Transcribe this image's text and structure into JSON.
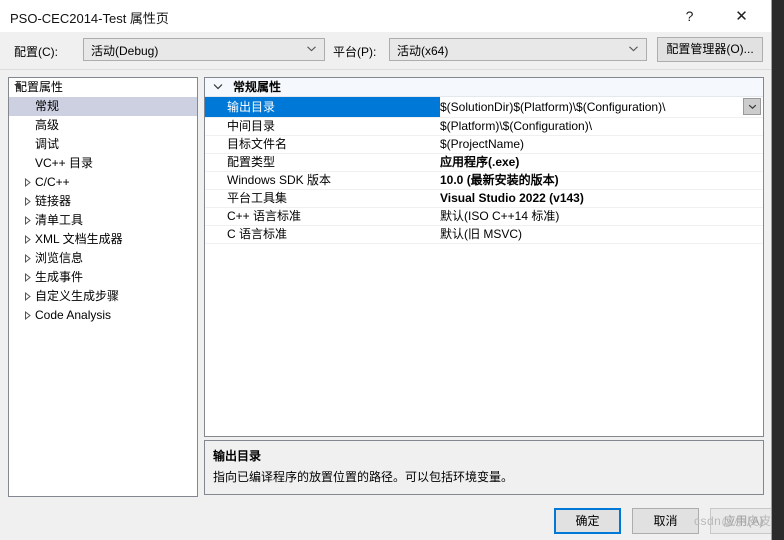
{
  "window": {
    "title": "PSO-CEC2014-Test 属性页",
    "help_icon": "question-mark-icon",
    "close_icon": "close-icon"
  },
  "configbar": {
    "config_label": "配置(C):",
    "config_value": "活动(Debug)",
    "platform_label": "平台(P):",
    "platform_value": "活动(x64)",
    "config_manager_label": "配置管理器(O)..."
  },
  "tree": {
    "root": {
      "label": "配置属性",
      "expanded": true
    },
    "items": [
      {
        "label": "常规",
        "selected": true,
        "expandable": false
      },
      {
        "label": "高级",
        "selected": false,
        "expandable": false
      },
      {
        "label": "调试",
        "selected": false,
        "expandable": false
      },
      {
        "label": "VC++ 目录",
        "selected": false,
        "expandable": false
      },
      {
        "label": "C/C++",
        "selected": false,
        "expandable": true
      },
      {
        "label": "链接器",
        "selected": false,
        "expandable": true
      },
      {
        "label": "清单工具",
        "selected": false,
        "expandable": true
      },
      {
        "label": "XML 文档生成器",
        "selected": false,
        "expandable": true
      },
      {
        "label": "浏览信息",
        "selected": false,
        "expandable": true
      },
      {
        "label": "生成事件",
        "selected": false,
        "expandable": true
      },
      {
        "label": "自定义生成步骤",
        "selected": false,
        "expandable": true
      },
      {
        "label": "Code Analysis",
        "selected": false,
        "expandable": true
      }
    ]
  },
  "properties": {
    "section_title": "常规属性",
    "rows": [
      {
        "name": "输出目录",
        "value": "$(SolutionDir)$(Platform)\\$(Configuration)\\",
        "bold": false,
        "selected": true
      },
      {
        "name": "中间目录",
        "value": "$(Platform)\\$(Configuration)\\",
        "bold": false,
        "selected": false
      },
      {
        "name": "目标文件名",
        "value": "$(ProjectName)",
        "bold": false,
        "selected": false
      },
      {
        "name": "配置类型",
        "value": "应用程序(.exe)",
        "bold": true,
        "selected": false
      },
      {
        "name": "Windows SDK 版本",
        "value": "10.0 (最新安装的版本)",
        "bold": true,
        "selected": false
      },
      {
        "name": "平台工具集",
        "value": "Visual Studio 2022 (v143)",
        "bold": true,
        "selected": false
      },
      {
        "name": "C++ 语言标准",
        "value": "默认(ISO C++14 标准)",
        "bold": false,
        "selected": false
      },
      {
        "name": "C 语言标准",
        "value": "默认(旧 MSVC)",
        "bold": false,
        "selected": false
      }
    ]
  },
  "description": {
    "title": "输出目录",
    "body": "指向已编译程序的放置位置的路径。可以包括环境变量。"
  },
  "footer": {
    "ok_label": "确定",
    "cancel_label": "取消",
    "apply_label": "应用(A)",
    "apply_disabled": true
  },
  "watermark": {
    "text": "csdn@小皮皮"
  },
  "colors": {
    "accent": "#0078d7",
    "dialog_bg": "#f0f0f0",
    "panel_bg": "#ffffff",
    "tree_selected": "#cdd0e0",
    "border": "#828790"
  }
}
